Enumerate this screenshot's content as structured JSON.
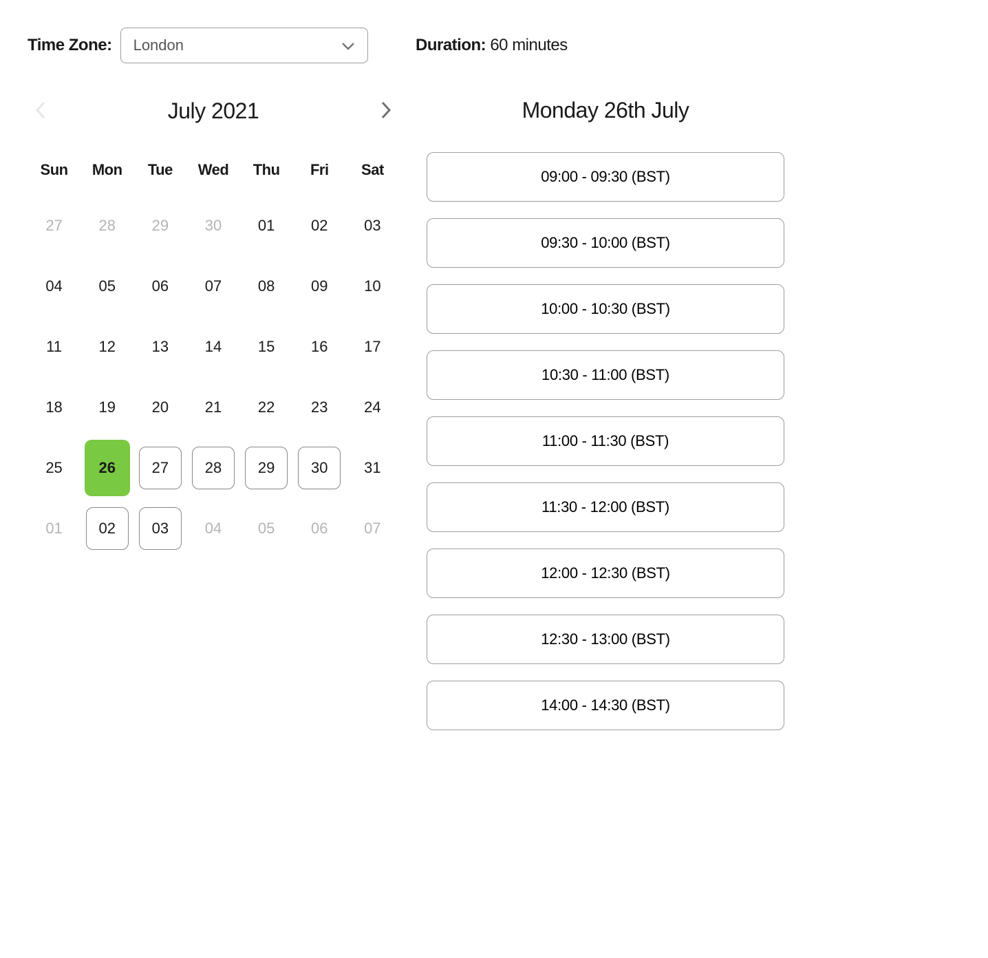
{
  "timezone": {
    "label": "Time Zone:",
    "selected": "London"
  },
  "duration": {
    "label": "Duration:",
    "value": "60 minutes"
  },
  "calendar": {
    "month_label": "July 2021",
    "weekdays": [
      "Sun",
      "Mon",
      "Tue",
      "Wed",
      "Thu",
      "Fri",
      "Sat"
    ],
    "weeks": [
      [
        {
          "d": "27",
          "other": true,
          "avail": false,
          "sel": false
        },
        {
          "d": "28",
          "other": true,
          "avail": false,
          "sel": false
        },
        {
          "d": "29",
          "other": true,
          "avail": false,
          "sel": false
        },
        {
          "d": "30",
          "other": true,
          "avail": false,
          "sel": false
        },
        {
          "d": "01",
          "other": false,
          "avail": false,
          "sel": false
        },
        {
          "d": "02",
          "other": false,
          "avail": false,
          "sel": false
        },
        {
          "d": "03",
          "other": false,
          "avail": false,
          "sel": false
        }
      ],
      [
        {
          "d": "04",
          "other": false,
          "avail": false,
          "sel": false
        },
        {
          "d": "05",
          "other": false,
          "avail": false,
          "sel": false
        },
        {
          "d": "06",
          "other": false,
          "avail": false,
          "sel": false
        },
        {
          "d": "07",
          "other": false,
          "avail": false,
          "sel": false
        },
        {
          "d": "08",
          "other": false,
          "avail": false,
          "sel": false
        },
        {
          "d": "09",
          "other": false,
          "avail": false,
          "sel": false
        },
        {
          "d": "10",
          "other": false,
          "avail": false,
          "sel": false
        }
      ],
      [
        {
          "d": "11",
          "other": false,
          "avail": false,
          "sel": false
        },
        {
          "d": "12",
          "other": false,
          "avail": false,
          "sel": false
        },
        {
          "d": "13",
          "other": false,
          "avail": false,
          "sel": false
        },
        {
          "d": "14",
          "other": false,
          "avail": false,
          "sel": false
        },
        {
          "d": "15",
          "other": false,
          "avail": false,
          "sel": false
        },
        {
          "d": "16",
          "other": false,
          "avail": false,
          "sel": false
        },
        {
          "d": "17",
          "other": false,
          "avail": false,
          "sel": false
        }
      ],
      [
        {
          "d": "18",
          "other": false,
          "avail": false,
          "sel": false
        },
        {
          "d": "19",
          "other": false,
          "avail": false,
          "sel": false
        },
        {
          "d": "20",
          "other": false,
          "avail": false,
          "sel": false
        },
        {
          "d": "21",
          "other": false,
          "avail": false,
          "sel": false
        },
        {
          "d": "22",
          "other": false,
          "avail": false,
          "sel": false
        },
        {
          "d": "23",
          "other": false,
          "avail": false,
          "sel": false
        },
        {
          "d": "24",
          "other": false,
          "avail": false,
          "sel": false
        }
      ],
      [
        {
          "d": "25",
          "other": false,
          "avail": false,
          "sel": false
        },
        {
          "d": "26",
          "other": false,
          "avail": false,
          "sel": true
        },
        {
          "d": "27",
          "other": false,
          "avail": true,
          "sel": false
        },
        {
          "d": "28",
          "other": false,
          "avail": true,
          "sel": false
        },
        {
          "d": "29",
          "other": false,
          "avail": true,
          "sel": false
        },
        {
          "d": "30",
          "other": false,
          "avail": true,
          "sel": false
        },
        {
          "d": "31",
          "other": false,
          "avail": false,
          "sel": false
        }
      ],
      [
        {
          "d": "01",
          "other": true,
          "avail": false,
          "sel": false
        },
        {
          "d": "02",
          "other": false,
          "avail": true,
          "sel": false
        },
        {
          "d": "03",
          "other": false,
          "avail": true,
          "sel": false
        },
        {
          "d": "04",
          "other": true,
          "avail": false,
          "sel": false
        },
        {
          "d": "05",
          "other": true,
          "avail": false,
          "sel": false
        },
        {
          "d": "06",
          "other": true,
          "avail": false,
          "sel": false
        },
        {
          "d": "07",
          "other": true,
          "avail": false,
          "sel": false
        }
      ]
    ]
  },
  "slots": {
    "title": "Monday 26th July",
    "items": [
      "09:00 - 09:30 (BST)",
      "09:30 - 10:00 (BST)",
      "10:00 - 10:30 (BST)",
      "10:30 - 11:00 (BST)",
      "11:00 - 11:30 (BST)",
      "11:30 - 12:00 (BST)",
      "12:00 - 12:30 (BST)",
      "12:30 - 13:00 (BST)",
      "14:00 - 14:30 (BST)"
    ]
  }
}
